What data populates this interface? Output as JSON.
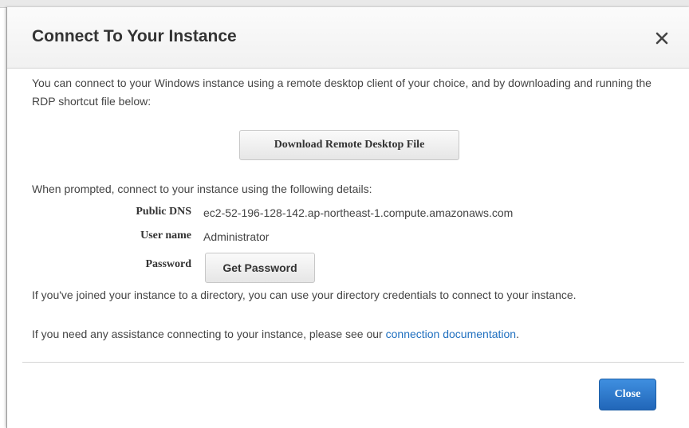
{
  "dialog": {
    "title": "Connect To Your Instance",
    "close_icon": "close-x-icon"
  },
  "body": {
    "intro": "You can connect to your Windows instance using a remote desktop client of your choice, and by downloading and running the RDP shortcut file below:",
    "download_button": "Download Remote Desktop File",
    "prompt": "When prompted, connect to your instance using the following details:",
    "details": {
      "public_dns_label": "Public DNS",
      "public_dns_value": "ec2-52-196-128-142.ap-northeast-1.compute.amazonaws.com",
      "user_name_label": "User name",
      "user_name_value": "Administrator",
      "password_label": "Password",
      "password_button": "Get Password"
    },
    "directory_note": "If you've joined your instance to a directory, you can use your directory credentials to connect to your instance.",
    "assist_prefix": "If you need any assistance connecting to your instance, please see our",
    "assist_link": "connection documentation",
    "assist_suffix": "."
  },
  "footer": {
    "close_button": "Close"
  },
  "colors": {
    "primary_button": "#2a74c6",
    "link": "#1f6fbf"
  }
}
